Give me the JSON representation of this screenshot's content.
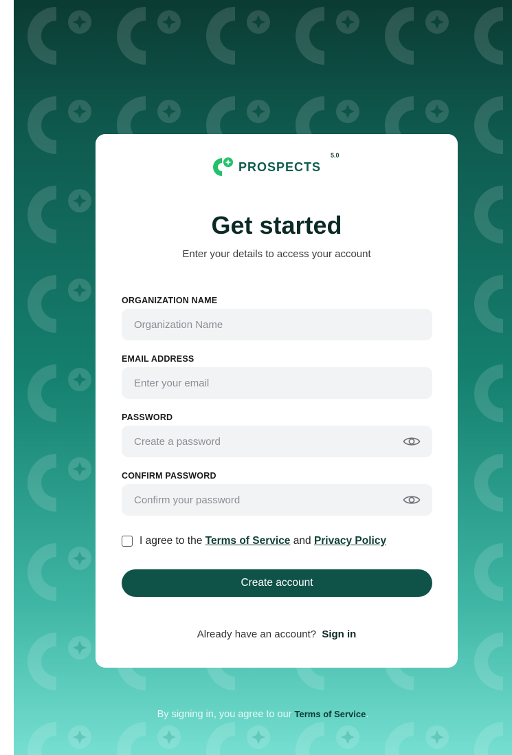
{
  "brand": {
    "name": "PROSPECTS",
    "version": "5.0",
    "logo_icon": "prospects-logo-icon"
  },
  "header": {
    "title": "Get started",
    "subtitle": "Enter your details to access your account"
  },
  "form": {
    "organization": {
      "label": "ORGANIZATION NAME",
      "placeholder": "Organization Name",
      "value": ""
    },
    "email": {
      "label": "EMAIL ADDRESS",
      "placeholder": "Enter your email",
      "value": ""
    },
    "password": {
      "label": "PASSWORD",
      "placeholder": "Create a password",
      "value": "",
      "icon": "eye-icon"
    },
    "confirm_password": {
      "label": "CONFIRM PASSWORD",
      "placeholder": "Confirm your password",
      "value": "",
      "icon": "eye-icon"
    },
    "agree": {
      "prefix": "I agree to the",
      "terms": "Terms of Service",
      "and": "and",
      "privacy": "Privacy Policy",
      "checked": false
    },
    "submit_label": "Create account"
  },
  "signin": {
    "prompt": "Already have an account?",
    "link": "Sign in"
  },
  "footer": {
    "text": "By signing in, you agree to our",
    "link": "Terms of Service",
    "suffix": "."
  },
  "colors": {
    "primary": "#0f5248",
    "brand_green": "#23c16b",
    "background_top": "#0b3b33",
    "background_bottom": "#76dfd1",
    "input_bg": "#f1f3f5"
  }
}
